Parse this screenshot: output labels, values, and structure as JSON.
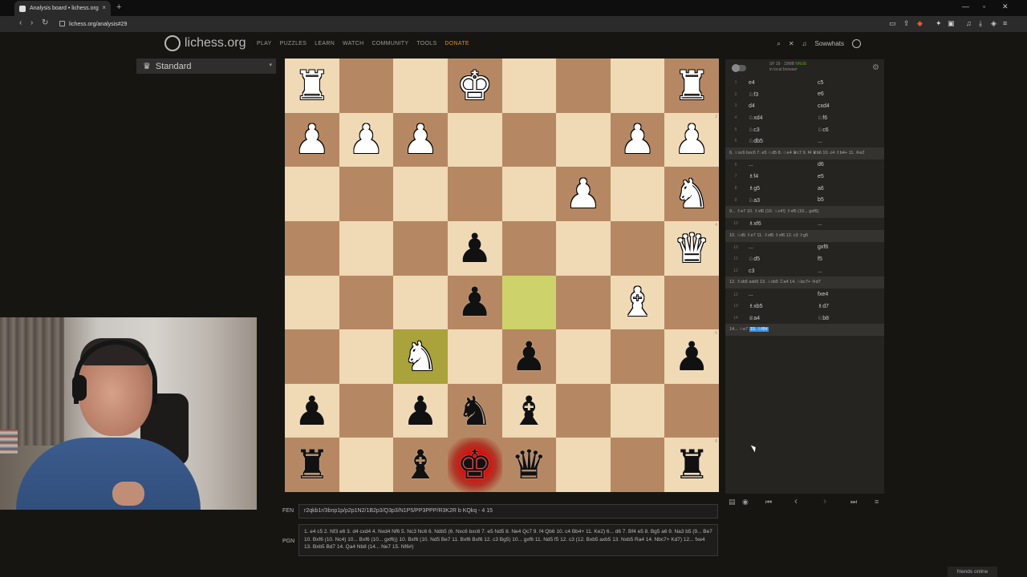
{
  "browser": {
    "tab_title": "Analysis board • lichess.org",
    "url": "lichess.org/analysis#29",
    "new_tab": "+",
    "close_tab": "×"
  },
  "header": {
    "logo_text": "lichess.org",
    "nav": [
      "PLAY",
      "PUZZLES",
      "LEARN",
      "WATCH",
      "COMMUNITY",
      "TOOLS",
      "DONATE"
    ],
    "username": "Sowwhats"
  },
  "variant": {
    "label": "Standard"
  },
  "board": {
    "ranks": [
      [
        {
          "c": "w",
          "p": "♜"
        },
        {
          "c": "",
          "p": ""
        },
        {
          "c": "",
          "p": ""
        },
        {
          "c": "w",
          "p": "♚"
        },
        {
          "c": "",
          "p": ""
        },
        {
          "c": "",
          "p": ""
        },
        {
          "c": "",
          "p": ""
        },
        {
          "c": "w",
          "p": "♜"
        }
      ],
      [
        {
          "c": "w",
          "p": "♟"
        },
        {
          "c": "w",
          "p": "♟"
        },
        {
          "c": "w",
          "p": "♟"
        },
        {
          "c": "",
          "p": ""
        },
        {
          "c": "",
          "p": ""
        },
        {
          "c": "",
          "p": ""
        },
        {
          "c": "w",
          "p": "♟"
        },
        {
          "c": "w",
          "p": "♟"
        }
      ],
      [
        {
          "c": "",
          "p": ""
        },
        {
          "c": "",
          "p": ""
        },
        {
          "c": "",
          "p": ""
        },
        {
          "c": "",
          "p": ""
        },
        {
          "c": "",
          "p": ""
        },
        {
          "c": "w",
          "p": "♟"
        },
        {
          "c": "",
          "p": ""
        },
        {
          "c": "w",
          "p": "♞"
        }
      ],
      [
        {
          "c": "",
          "p": ""
        },
        {
          "c": "",
          "p": ""
        },
        {
          "c": "",
          "p": ""
        },
        {
          "c": "b",
          "p": "♟"
        },
        {
          "c": "",
          "p": ""
        },
        {
          "c": "",
          "p": ""
        },
        {
          "c": "",
          "p": ""
        },
        {
          "c": "w",
          "p": "♛"
        }
      ],
      [
        {
          "c": "",
          "p": ""
        },
        {
          "c": "",
          "p": ""
        },
        {
          "c": "",
          "p": ""
        },
        {
          "c": "b",
          "p": "♟"
        },
        {
          "c": "",
          "p": ""
        },
        {
          "c": "",
          "p": ""
        },
        {
          "c": "w",
          "p": "♝"
        },
        {
          "c": "",
          "p": ""
        }
      ],
      [
        {
          "c": "",
          "p": ""
        },
        {
          "c": "",
          "p": ""
        },
        {
          "c": "w",
          "p": "♞"
        },
        {
          "c": "",
          "p": ""
        },
        {
          "c": "b",
          "p": "♟"
        },
        {
          "c": "",
          "p": ""
        },
        {
          "c": "",
          "p": ""
        },
        {
          "c": "b",
          "p": "♟"
        }
      ],
      [
        {
          "c": "b",
          "p": "♟"
        },
        {
          "c": "",
          "p": ""
        },
        {
          "c": "b",
          "p": "♟"
        },
        {
          "c": "b",
          "p": "♞"
        },
        {
          "c": "b",
          "p": "♝"
        },
        {
          "c": "",
          "p": ""
        },
        {
          "c": "",
          "p": ""
        },
        {
          "c": "",
          "p": ""
        }
      ],
      [
        {
          "c": "b",
          "p": "♜"
        },
        {
          "c": "",
          "p": ""
        },
        {
          "c": "b",
          "p": "♝"
        },
        {
          "c": "b",
          "p": "♚"
        },
        {
          "c": "b",
          "p": "♛"
        },
        {
          "c": "",
          "p": ""
        },
        {
          "c": "",
          "p": ""
        },
        {
          "c": "b",
          "p": "♜"
        }
      ]
    ],
    "rank_labels": [
      "1",
      "2",
      "3",
      "4",
      "5",
      "6",
      "7",
      "8"
    ]
  },
  "engine": {
    "name": "SF 18 · 15MB",
    "nnue": "NNUE",
    "status": "in local browser"
  },
  "moves": [
    {
      "type": "row",
      "n": "1",
      "w": "e4",
      "b": "c5"
    },
    {
      "type": "row",
      "n": "2",
      "w": "♘f3",
      "b": "e6"
    },
    {
      "type": "row",
      "n": "3",
      "w": "d4",
      "b": "cxd4"
    },
    {
      "type": "row",
      "n": "4",
      "w": "♘xd4",
      "b": "♘f6"
    },
    {
      "type": "row",
      "n": "5",
      "w": "♘c3",
      "b": "♘c6"
    },
    {
      "type": "row",
      "n": "6",
      "w": "♘db5",
      "b": "..."
    },
    {
      "type": "var",
      "t": "6. ♘xc6 bxc6 7. e5 ♘d5 8. ♘e4 ♛c7 9. f4 ♛b6 10. c4 ♗b4+ 11. ♔e2"
    },
    {
      "type": "row",
      "n": "6",
      "w": "...",
      "b": "d6"
    },
    {
      "type": "row",
      "n": "7",
      "w": "♗f4",
      "b": "e5"
    },
    {
      "type": "row",
      "n": "8",
      "w": "♗g5",
      "b": "a6"
    },
    {
      "type": "row",
      "n": "9",
      "w": "♘a3",
      "b": "b5"
    },
    {
      "type": "var",
      "t": "9... ♗e7 10. ♗xf6 (10. ♘c4!) ♗xf6 (10... gxf6)"
    },
    {
      "type": "row",
      "n": "10",
      "w": "♗xf6",
      "b": "..."
    },
    {
      "type": "var",
      "t": "10. ♘d5 ♗e7 11. ♗xf6 ♗xf6 12. c3 ♗g5"
    },
    {
      "type": "row",
      "n": "10",
      "w": "...",
      "b": "gxf6"
    },
    {
      "type": "row",
      "n": "11",
      "w": "♘d5",
      "b": "f5"
    },
    {
      "type": "row",
      "n": "12",
      "w": "c3",
      "b": "..."
    },
    {
      "type": "var",
      "t": "12. ♗xb5 axb5 13. ♘xb5 ♖a4 14. ♘bc7+ ♔d7"
    },
    {
      "type": "row",
      "n": "12",
      "w": "...",
      "b": "fxe4"
    },
    {
      "type": "row",
      "n": "13",
      "w": "♗xb5",
      "b": "♗d7"
    },
    {
      "type": "row",
      "n": "14",
      "w": "♕a4",
      "b": "♘b8"
    }
  ],
  "last_var_prefix": "14... ♘e7",
  "last_var_selected": "15. ♘f6#",
  "fen": {
    "label": "FEN",
    "value": "r2qkb1r/3bnp1p/p2p1N2/1B2p3/Q3p3/N1P5/PP3PPP/R3K2R b KQkq - 4 15"
  },
  "pgn": {
    "label": "PGN",
    "value": "1. e4 c5 2. Nf3 e6 3. d4 cxd4 4. Nxd4 Nf6 5. Nc3 Nc6 6. Ndb5 (6. Nxc6 bxc6 7. e5 Nd5 8. Ne4 Qc7 9. f4 Qb6 10. c4 Bb4+ 11. Ke2) 6... d6 7. Bf4 e5 8. Bg5 a6 9. Na3 b5 (9... Be7 10. Bxf6 (10. Nc4) 10... Bxf6 (10... gxf6)) 10. Bxf6 (10. Nd5 Be7 11. Bxf6 Bxf6 12. c3 Bg5) 10... gxf6 11. Nd5 f5 12. c3 (12. Bxb5 axb5 13. Nxb5 Ra4 14. Nbc7+ Kd7) 12... fxe4 13. Bxb5 Bd7 14. Qa4 Nb8 (14... Ne7 15. Nf6#)"
  },
  "friends": "friends online",
  "colors": {
    "light_square": "#f0d9b5",
    "dark_square": "#b58863",
    "highlight": "#cdd26a",
    "donate": "#d59120",
    "selected": "#3692e7"
  }
}
